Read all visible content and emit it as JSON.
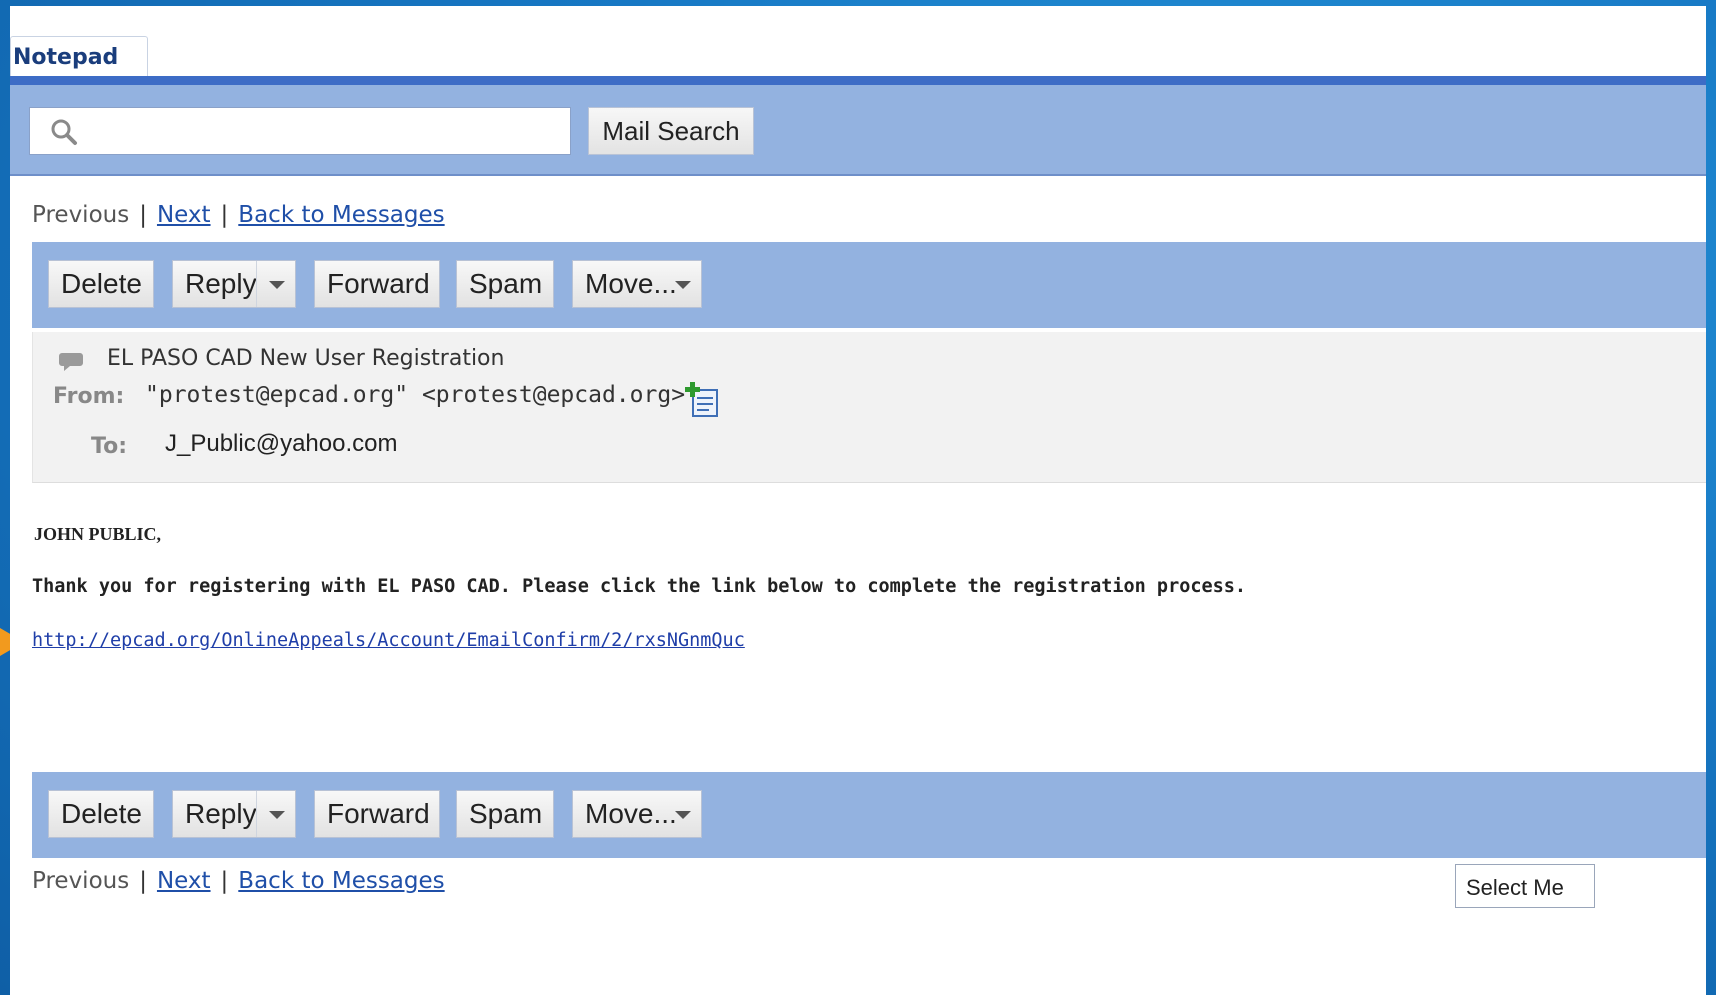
{
  "tabs": {
    "notepad": "Notepad"
  },
  "search": {
    "placeholder": "",
    "button_label": "Mail Search"
  },
  "nav": {
    "previous": "Previous",
    "next": "Next",
    "back": "Back to Messages",
    "separator": "|"
  },
  "toolbar": {
    "delete": "Delete",
    "reply": "Reply",
    "forward": "Forward",
    "spam": "Spam",
    "move": "Move..."
  },
  "message": {
    "subject": "EL PASO CAD New User Registration",
    "from_label": "From:",
    "from_value": "\"protest@epcad.org\" <protest@epcad.org>",
    "to_label": "To:",
    "to_value": "J_Public@yahoo.com"
  },
  "body": {
    "greeting": "JOHN PUBLIC,",
    "text": "Thank you for registering with EL PASO CAD. Please click the link below to complete the registration process.",
    "link": "http://epcad.org/OnlineAppeals/Account/EmailConfirm/2/rxsNGnmQuc"
  },
  "select": {
    "label": "Select Me"
  },
  "colors": {
    "toolbar_bg": "#93b2e0",
    "accent": "#3d6cc6",
    "link": "#1f4fa8",
    "arrow": "#f29a1e"
  }
}
